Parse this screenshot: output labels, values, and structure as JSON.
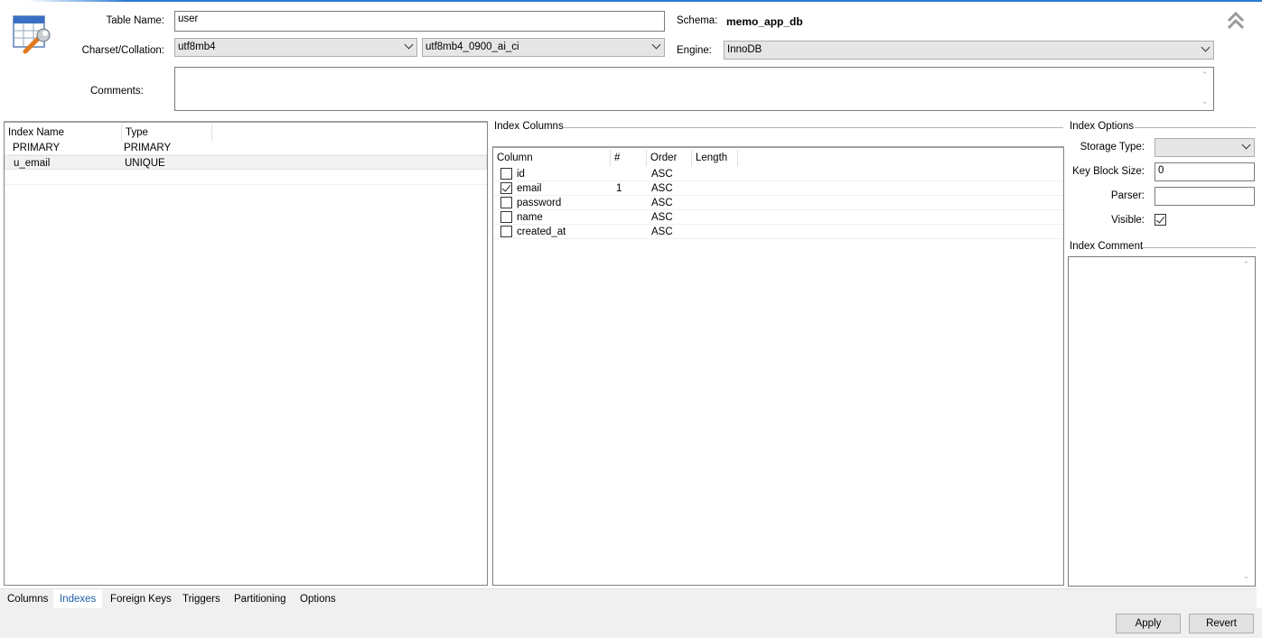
{
  "header": {
    "table_name_label": "Table Name:",
    "table_name_value": "user",
    "schema_label": "Schema:",
    "schema_value": "memo_app_db",
    "charset_label": "Charset/Collation:",
    "charset_value": "utf8mb4",
    "collation_value": "utf8mb4_0900_ai_ci",
    "engine_label": "Engine:",
    "engine_value": "InnoDB",
    "comments_label": "Comments:",
    "comments_value": ""
  },
  "index_list": {
    "columns": [
      "Index Name",
      "Type"
    ],
    "rows": [
      {
        "name": "PRIMARY",
        "type": "PRIMARY",
        "selected": false
      },
      {
        "name": "u_email",
        "type": "UNIQUE",
        "selected": true
      }
    ]
  },
  "index_columns": {
    "title": "Index Columns",
    "columns": [
      "Column",
      "#",
      "Order",
      "Length"
    ],
    "rows": [
      {
        "column": "id",
        "checked": false,
        "num": "",
        "order": "ASC",
        "length": ""
      },
      {
        "column": "email",
        "checked": true,
        "num": "1",
        "order": "ASC",
        "length": ""
      },
      {
        "column": "password",
        "checked": false,
        "num": "",
        "order": "ASC",
        "length": ""
      },
      {
        "column": "name",
        "checked": false,
        "num": "",
        "order": "ASC",
        "length": ""
      },
      {
        "column": "created_at",
        "checked": false,
        "num": "",
        "order": "ASC",
        "length": ""
      }
    ]
  },
  "index_options": {
    "title": "Index Options",
    "storage_type_label": "Storage Type:",
    "storage_type_value": "",
    "key_block_size_label": "Key Block Size:",
    "key_block_size_value": "0",
    "parser_label": "Parser:",
    "parser_value": "",
    "visible_label": "Visible:",
    "visible_checked": true,
    "comment_title": "Index Comment",
    "comment_value": ""
  },
  "tabs": [
    {
      "label": "Columns",
      "active": false
    },
    {
      "label": "Indexes",
      "active": true
    },
    {
      "label": "Foreign Keys",
      "active": false
    },
    {
      "label": "Triggers",
      "active": false
    },
    {
      "label": "Partitioning",
      "active": false
    },
    {
      "label": "Options",
      "active": false
    }
  ],
  "buttons": {
    "apply": "Apply",
    "revert": "Revert"
  },
  "icons": {
    "table_icon": "table-edit-icon",
    "collapse": "double-chevron-up-icon"
  },
  "colors": {
    "accent": "#2b7ad6",
    "active_tab_text": "#1c5fa8"
  }
}
